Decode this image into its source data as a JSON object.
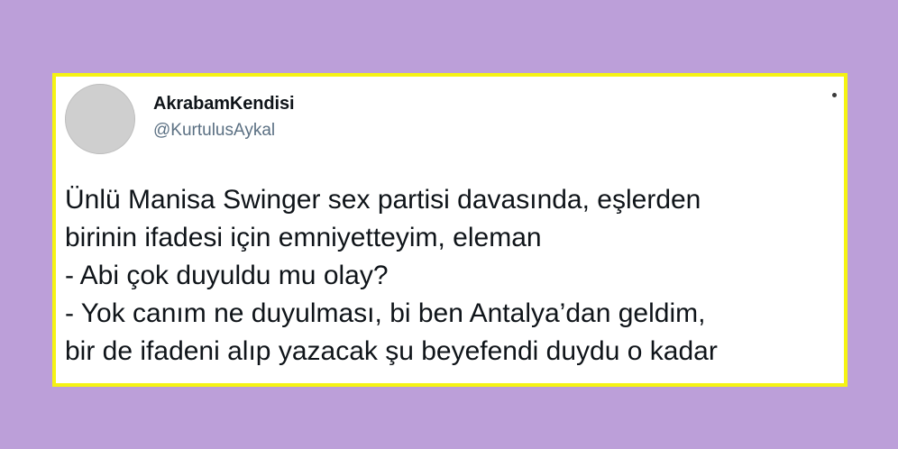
{
  "tweet": {
    "display_name": "AkrabamKendisi",
    "handle": "@KurtulusAykal",
    "lines": [
      "Ünlü Manisa Swinger sex partisi davasında, eşlerden",
      "birinin ifadesi için emniyetteyim, eleman",
      "- Abi çok duyuldu mu olay?",
      "- Yok canım ne duyulması, bi ben Antalya’dan geldim,",
      "bir de ifadeni alıp yazacak şu beyefendi duydu o kadar"
    ]
  },
  "colors": {
    "page_background": "#bc9fd9",
    "card_border": "#f5f313",
    "card_background": "#ffffff",
    "text": "#0f1419",
    "handle_text": "#5b7083"
  },
  "icons": {
    "more": "more-dot-icon",
    "avatar": "avatar-photo"
  }
}
